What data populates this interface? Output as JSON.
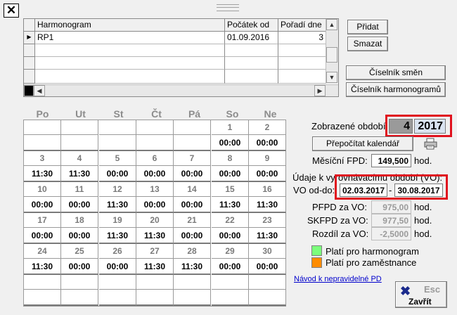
{
  "window": {
    "close_glyph": "✕"
  },
  "harmonogram_table": {
    "columns": [
      "Harmonogram",
      "Počátek od",
      "Pořadí dne"
    ],
    "rows": [
      {
        "name": "RP1",
        "start": "01.09.2016",
        "order": "3"
      }
    ]
  },
  "buttons": {
    "add": "Přidat",
    "delete": "Smazat",
    "shift_codes": "Číselník směn",
    "harmonogram_codes": "Číselník harmonogramů",
    "recalc": "Přepočítat kalendář",
    "close_hint": "Esc",
    "close": "Zavřít"
  },
  "calendar": {
    "day_headers": [
      "Po",
      "Ut",
      "St",
      "Čt",
      "Pá",
      "So",
      "Ne"
    ],
    "weeks": [
      [
        {
          "d": "",
          "t": ""
        },
        {
          "d": "",
          "t": ""
        },
        {
          "d": "",
          "t": ""
        },
        {
          "d": "",
          "t": ""
        },
        {
          "d": "",
          "t": ""
        },
        {
          "d": "1",
          "t": "00:00"
        },
        {
          "d": "2",
          "t": "00:00"
        }
      ],
      [
        {
          "d": "3",
          "t": "11:30"
        },
        {
          "d": "4",
          "t": "11:30"
        },
        {
          "d": "5",
          "t": "00:00"
        },
        {
          "d": "6",
          "t": "00:00"
        },
        {
          "d": "7",
          "t": "00:00"
        },
        {
          "d": "8",
          "t": "00:00"
        },
        {
          "d": "9",
          "t": "00:00"
        }
      ],
      [
        {
          "d": "10",
          "t": "00:00"
        },
        {
          "d": "11",
          "t": "00:00"
        },
        {
          "d": "12",
          "t": "11:30"
        },
        {
          "d": "13",
          "t": "00:00"
        },
        {
          "d": "14",
          "t": "00:00"
        },
        {
          "d": "15",
          "t": "11:30"
        },
        {
          "d": "16",
          "t": "11:30"
        }
      ],
      [
        {
          "d": "17",
          "t": "00:00"
        },
        {
          "d": "18",
          "t": "00:00"
        },
        {
          "d": "19",
          "t": "11:30"
        },
        {
          "d": "20",
          "t": "11:30"
        },
        {
          "d": "21",
          "t": "00:00"
        },
        {
          "d": "22",
          "t": "00:00"
        },
        {
          "d": "23",
          "t": "11:30"
        }
      ],
      [
        {
          "d": "24",
          "t": "11:30"
        },
        {
          "d": "25",
          "t": "00:00"
        },
        {
          "d": "26",
          "t": "00:00"
        },
        {
          "d": "27",
          "t": "11:30"
        },
        {
          "d": "28",
          "t": "11:30"
        },
        {
          "d": "29",
          "t": "00:00"
        },
        {
          "d": "30",
          "t": "00:00"
        }
      ],
      [
        {
          "d": "",
          "t": ""
        },
        {
          "d": "",
          "t": ""
        },
        {
          "d": "",
          "t": ""
        },
        {
          "d": "",
          "t": ""
        },
        {
          "d": "",
          "t": ""
        },
        {
          "d": "",
          "t": ""
        },
        {
          "d": "",
          "t": ""
        }
      ]
    ]
  },
  "period": {
    "label": "Zobrazené období",
    "month": "4",
    "year": "2017"
  },
  "fpd": {
    "label": "Měsíční FPD:",
    "value": "149,500",
    "unit": "hod."
  },
  "vo": {
    "heading": "Údaje k vyrovnávacímu období (VO):",
    "range_label": "VO od-do:",
    "from": "02.03.2017",
    "sep": "-",
    "to": "30.08.2017",
    "pfpd_label": "PFPD za VO:",
    "pfpd_value": "975,00",
    "skfpd_label": "SKFPD za VO:",
    "skfpd_value": "977,50",
    "diff_label": "Rozdíl za VO:",
    "diff_value": "-2,5000",
    "unit": "hod."
  },
  "legend": {
    "harmonogram": "Platí pro harmonogram",
    "employee": "Platí pro zaměstnance",
    "harmonogram_color": "#7cff7c",
    "employee_color": "#ff8c00"
  },
  "link": "Návod k nepravidelné PD",
  "highlight_color": "#e0121e"
}
